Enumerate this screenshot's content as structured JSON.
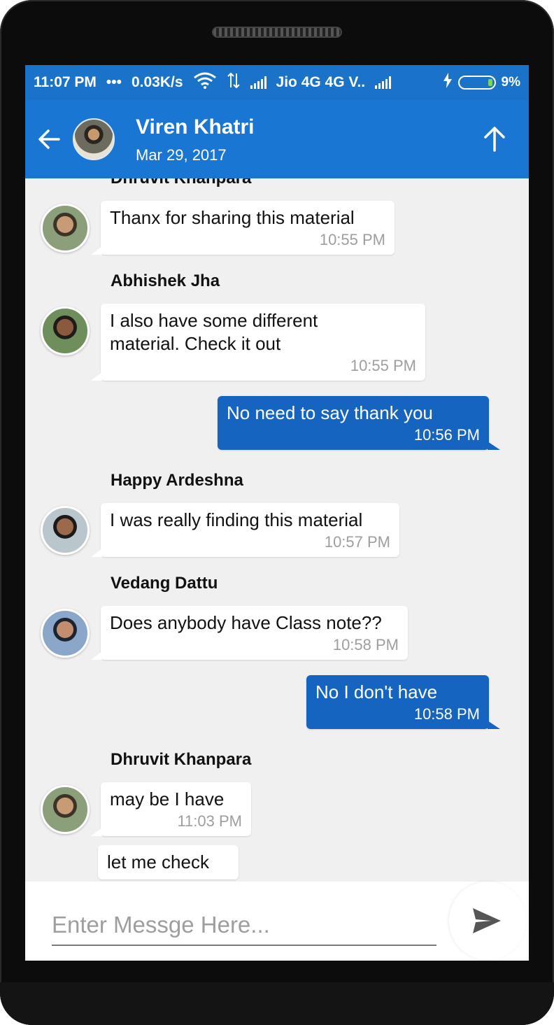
{
  "status": {
    "time": "11:07 PM",
    "speed": "0.03K/s",
    "carrier": "Jio 4G 4G V..",
    "battery": "9%"
  },
  "header": {
    "title": "Viren Khatri",
    "subtitle": "Mar 29, 2017"
  },
  "chat": {
    "top_sender": "Dhruvit Khanpara",
    "messages": [
      {
        "text": "Thanx for sharing this material",
        "time": "10:55 PM"
      },
      {
        "sender": "Abhishek Jha",
        "text": "I also have some different\nmaterial. Check it out",
        "time": "10:55 PM"
      },
      {
        "text": "No need to say thank you",
        "time": "10:56 PM"
      },
      {
        "sender": "Happy Ardeshna",
        "text": "I was really finding this material",
        "time": "10:57 PM"
      },
      {
        "sender": "Vedang Dattu",
        "text": "Does anybody have Class note??",
        "time": "10:58 PM"
      },
      {
        "text": "No I don't have",
        "time": "10:58 PM"
      },
      {
        "sender": "Dhruvit Khanpara",
        "text": "may be I have",
        "time": "11:03 PM"
      },
      {
        "text": "let me check"
      }
    ]
  },
  "composer": {
    "placeholder": "Enter Messge Here..."
  },
  "colors": {
    "status_bar": "#1a73c9",
    "app_bar": "#1976d2",
    "outgoing_bubble": "#1565c0",
    "chat_background": "#f0f0f0"
  }
}
